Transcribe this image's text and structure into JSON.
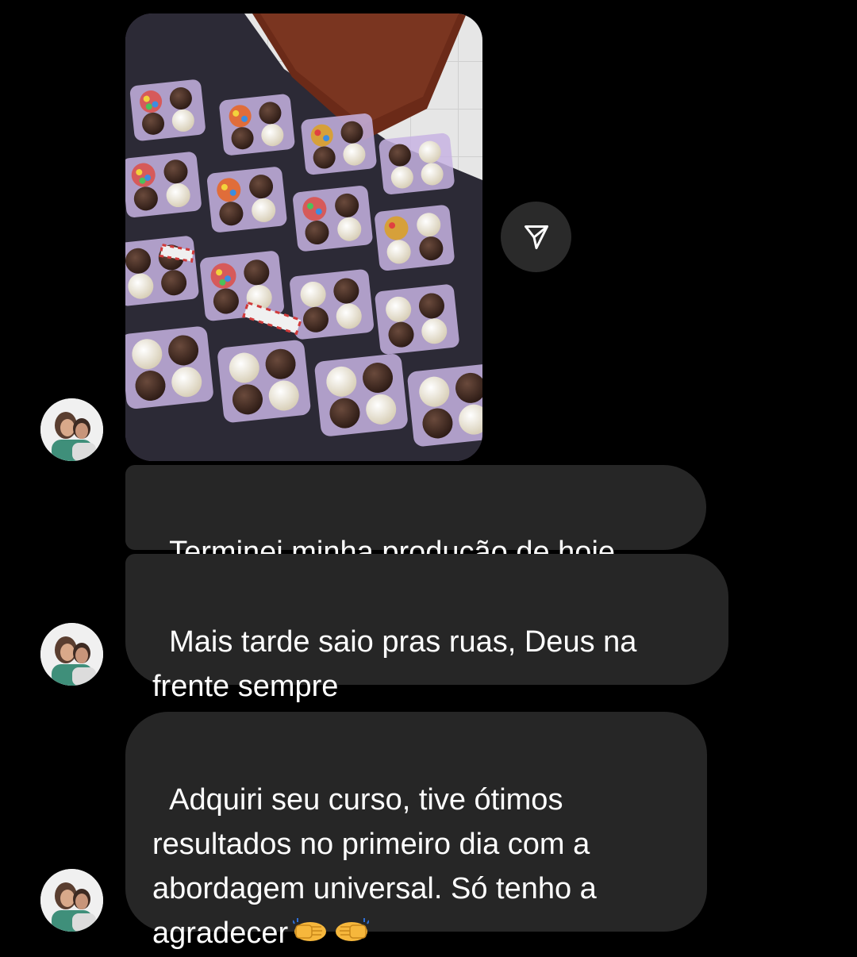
{
  "conversation": {
    "participant": {
      "avatar_icon": "profile-photo"
    },
    "image_message": {
      "description_icon": "photo-of-boxed-brigadeiros",
      "share_icon": "paper-plane-share-icon"
    },
    "messages": [
      {
        "text": "Terminei minha produção de hoje"
      },
      {
        "text": "Mais tarde saio pras ruas, Deus na\nfrente sempre"
      },
      {
        "text": "Adquiri seu curso, tive ótimos\nresultados no primeiro dia com a\nabordagem universal. Só tenho a\nagradecer",
        "emoji": "fist-bump-emoji"
      }
    ]
  },
  "colors": {
    "background": "#000000",
    "bubble": "#262626",
    "text": "#ffffff",
    "share_button": "#2a2a2a",
    "box_purple": "#b89cd8",
    "brigadeiro": "#3b2620",
    "beijinho": "#f2ead8"
  }
}
